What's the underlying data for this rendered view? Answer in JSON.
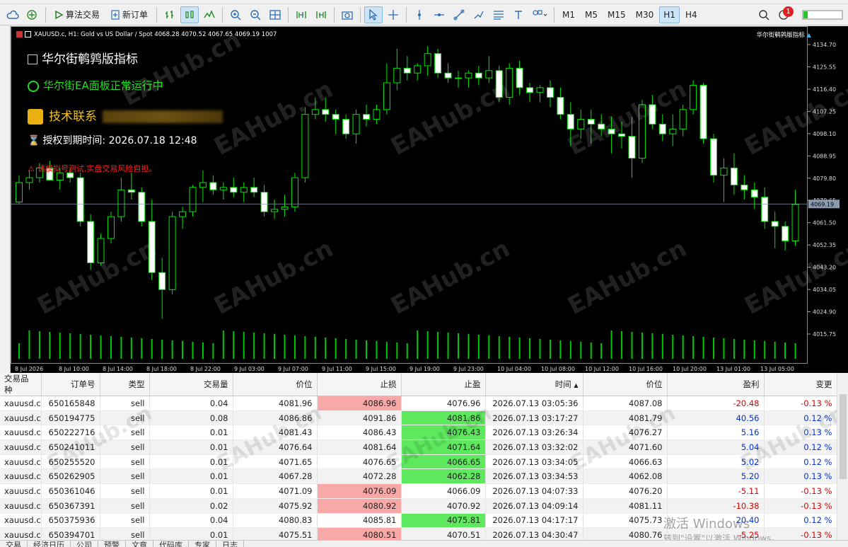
{
  "toolbar": {
    "algo_trading": "算法交易",
    "new_order": "新订单",
    "timeframes": [
      "M1",
      "M5",
      "M15",
      "M30",
      "H1",
      "H4"
    ],
    "active_timeframe": "H1",
    "notification_count": "1"
  },
  "chart": {
    "header": "XAUUSD.c, H1:  Gold vs US Dollar / Spot   4068.28 4070.52 4067.65 4069.19  1007",
    "top_right_label": "华尔街鹌鹑版指标",
    "indicator_title": "华尔街鹌鹑版指标",
    "status_line": "华尔街EA面板正常运行中",
    "contact_label": "技术联系",
    "expiry_label": "授权到期时间:",
    "expiry_value": "2026.07.18 12:48",
    "warning": "请模拟号测试,实盘交易风险自担。",
    "watermark": "EAHub.cn",
    "current_price": "4069.19",
    "price_ticks": [
      "4134.70",
      "4125.55",
      "4116.40",
      "4107.25",
      "4098.10",
      "4088.95",
      "4079.80",
      "4070.65",
      "4061.50",
      "4052.35",
      "4043.20",
      "4034.05",
      "4024.90",
      "4015.75"
    ],
    "time_ticks": [
      "8 Jul 2026",
      "8 Jul 10:00",
      "8 Jul 14:00",
      "8 Jul 18:00",
      "8 Jul 22:00",
      "9 Jul 03:00",
      "9 Jul 07:00",
      "9 Jul 11:00",
      "9 Jul 15:00",
      "9 Jul 19:00",
      "9 Jul 23:00",
      "10 Jul 04:00",
      "10 Jul 08:00",
      "10 Jul 12:00",
      "10 Jul 16:00",
      "10 Jul 20:00",
      "13 Jul 01:00",
      "13 Jul 05:00"
    ],
    "colors": {
      "bull": "#00e600",
      "bear_body": "#ffffff",
      "volume": "#00c800",
      "bg": "#000000"
    }
  },
  "chart_data": {
    "type": "candlestick",
    "symbol": "XAUUSD.c",
    "timeframe": "H1",
    "ylim": [
      4010,
      4138
    ],
    "candles": [
      [
        4070,
        4081,
        4069,
        4078
      ],
      [
        4078,
        4083,
        4075,
        4080
      ],
      [
        4080,
        4086,
        4078,
        4084
      ],
      [
        4084,
        4087,
        4080,
        4079
      ],
      [
        4079,
        4084,
        4075,
        4082
      ],
      [
        4082,
        4084,
        4078,
        4080
      ],
      [
        4080,
        4082,
        4060,
        4062
      ],
      [
        4062,
        4065,
        4042,
        4045
      ],
      [
        4045,
        4057,
        4044,
        4055
      ],
      [
        4055,
        4066,
        4053,
        4064
      ],
      [
        4064,
        4080,
        4062,
        4075
      ],
      [
        4075,
        4082,
        4071,
        4074
      ],
      [
        4074,
        4076,
        4060,
        4062
      ],
      [
        4062,
        4071,
        4038,
        4041
      ],
      [
        4041,
        4047,
        4022,
        4034
      ],
      [
        4034,
        4066,
        4032,
        4064
      ],
      [
        4064,
        4068,
        4059,
        4066
      ],
      [
        4066,
        4077,
        4064,
        4076
      ],
      [
        4076,
        4083,
        4070,
        4078
      ],
      [
        4078,
        4081,
        4073,
        4075
      ],
      [
        4075,
        4078,
        4071,
        4076
      ],
      [
        4076,
        4080,
        4072,
        4074
      ],
      [
        4074,
        4078,
        4070,
        4076
      ],
      [
        4076,
        4080,
        4072,
        4074
      ],
      [
        4074,
        4077,
        4064,
        4066
      ],
      [
        4066,
        4071,
        4063,
        4067
      ],
      [
        4067,
        4073,
        4064,
        4068
      ],
      [
        4068,
        4082,
        4066,
        4080
      ],
      [
        4080,
        4109,
        4078,
        4106
      ],
      [
        4106,
        4113,
        4104,
        4108
      ],
      [
        4108,
        4113,
        4103,
        4106
      ],
      [
        4106,
        4108,
        4098,
        4104
      ],
      [
        4104,
        4106,
        4096,
        4098
      ],
      [
        4098,
        4108,
        4094,
        4106
      ],
      [
        4106,
        4110,
        4101,
        4104
      ],
      [
        4104,
        4110,
        4102,
        4108
      ],
      [
        4108,
        4127,
        4106,
        4119
      ],
      [
        4119,
        4133,
        4116,
        4125
      ],
      [
        4125,
        4130,
        4120,
        4123
      ],
      [
        4123,
        4127,
        4120,
        4126
      ],
      [
        4126,
        4134,
        4122,
        4131
      ],
      [
        4131,
        4133,
        4121,
        4123
      ],
      [
        4123,
        4127,
        4119,
        4121
      ],
      [
        4121,
        4124,
        4117,
        4121
      ],
      [
        4121,
        4124,
        4117,
        4123
      ],
      [
        4123,
        4126,
        4118,
        4121
      ],
      [
        4121,
        4130,
        4119,
        4124
      ],
      [
        4124,
        4126,
        4111,
        4113
      ],
      [
        4113,
        4127,
        4110,
        4125
      ],
      [
        4125,
        4128,
        4114,
        4117
      ],
      [
        4117,
        4119,
        4111,
        4115
      ],
      [
        4115,
        4118,
        4111,
        4117
      ],
      [
        4117,
        4120,
        4109,
        4113
      ],
      [
        4113,
        4117,
        4104,
        4106
      ],
      [
        4106,
        4111,
        4093,
        4100
      ],
      [
        4100,
        4108,
        4096,
        4104
      ],
      [
        4104,
        4108,
        4094,
        4102
      ],
      [
        4102,
        4106,
        4097,
        4100
      ],
      [
        4100,
        4105,
        4090,
        4098
      ],
      [
        4098,
        4103,
        4092,
        4097
      ],
      [
        4097,
        4105,
        4080,
        4088
      ],
      [
        4088,
        4112,
        4086,
        4110
      ],
      [
        4110,
        4114,
        4100,
        4102
      ],
      [
        4102,
        4106,
        4095,
        4098
      ],
      [
        4098,
        4106,
        4093,
        4100
      ],
      [
        4100,
        4110,
        4097,
        4108
      ],
      [
        4108,
        4120,
        4106,
        4118
      ],
      [
        4118,
        4119,
        4094,
        4096
      ],
      [
        4096,
        4098,
        4078,
        4081
      ],
      [
        4081,
        4088,
        4070,
        4084
      ],
      [
        4084,
        4090,
        4073,
        4077
      ],
      [
        4077,
        4081,
        4071,
        4075
      ],
      [
        4075,
        4078,
        4067,
        4072
      ],
      [
        4072,
        4076,
        4059,
        4062
      ],
      [
        4062,
        4066,
        4051,
        4060
      ],
      [
        4060,
        4062,
        4050,
        4054
      ],
      [
        4054,
        4075,
        4052,
        4069
      ]
    ],
    "volume_note": "volume histogram at bottom, green bars"
  },
  "table": {
    "headers": [
      "交易品种",
      "订单号",
      "类型",
      "交易量",
      "价位",
      "止损",
      "止盈",
      "时间",
      "价位",
      "盈利",
      "变更"
    ],
    "rows": [
      [
        "xauusd.c",
        "650165848",
        "sell",
        "0.04",
        "4081.96",
        "4086.96",
        "4076.96",
        "2026.07.13 03:05:36",
        "4087.08",
        "-20.48",
        "-0.13 %"
      ],
      [
        "xauusd.c",
        "650194775",
        "sell",
        "0.08",
        "4086.86",
        "4091.86",
        "4081.86",
        "2026.07.13 03:17:27",
        "4081.79",
        "40.56",
        "0.12 %"
      ],
      [
        "xauusd.c",
        "650222716",
        "sell",
        "0.01",
        "4081.43",
        "4086.43",
        "4076.43",
        "2026.07.13 03:26:34",
        "4076.27",
        "5.16",
        "0.13 %"
      ],
      [
        "xauusd.c",
        "650241011",
        "sell",
        "0.01",
        "4076.64",
        "4081.64",
        "4071.64",
        "2026.07.13 03:32:02",
        "4071.60",
        "5.04",
        "0.12 %"
      ],
      [
        "xauusd.c",
        "650255520",
        "sell",
        "0.01",
        "4071.65",
        "4076.65",
        "4066.65",
        "2026.07.13 03:34:05",
        "4066.63",
        "5.02",
        "0.12 %"
      ],
      [
        "xauusd.c",
        "650262905",
        "sell",
        "0.01",
        "4067.28",
        "4072.28",
        "4062.28",
        "2026.07.13 03:34:53",
        "4062.08",
        "5.20",
        "0.13 %"
      ],
      [
        "xauusd.c",
        "650361046",
        "sell",
        "0.01",
        "4071.09",
        "4076.09",
        "4066.09",
        "2026.07.13 04:07:33",
        "4076.20",
        "-5.11",
        "-0.13 %"
      ],
      [
        "xauusd.c",
        "650367391",
        "sell",
        "0.02",
        "4075.92",
        "4080.92",
        "4070.92",
        "2026.07.13 04:09:14",
        "4081.11",
        "-10.38",
        "-0.13 %"
      ],
      [
        "xauusd.c",
        "650375936",
        "sell",
        "0.04",
        "4080.83",
        "4085.81",
        "4075.81",
        "2026.07.13 04:17:17",
        "4075.73",
        "20.40",
        "0.12 %"
      ],
      [
        "xauusd.c",
        "650394701",
        "sell",
        "0.01",
        "4075.51",
        "4080.51",
        "4070.51",
        "2026.07.13 04:30:47",
        "4080.76",
        "-5.25",
        "-0.13 %"
      ]
    ],
    "sl_highlight": [
      "red",
      "",
      "",
      "",
      "",
      "",
      "red",
      "red",
      "",
      "red"
    ],
    "tp_highlight": [
      "",
      "green",
      "green",
      "green",
      "green",
      "green",
      "",
      "",
      "green",
      ""
    ]
  },
  "bottom_tabs": [
    "交易",
    "经济日历",
    "公司",
    "预警",
    "文章",
    "代码库",
    "专家",
    "日志"
  ],
  "windows_activation": {
    "line1": "激活 Windows",
    "line2": "转到\"设置\"以激活 Windows。"
  }
}
